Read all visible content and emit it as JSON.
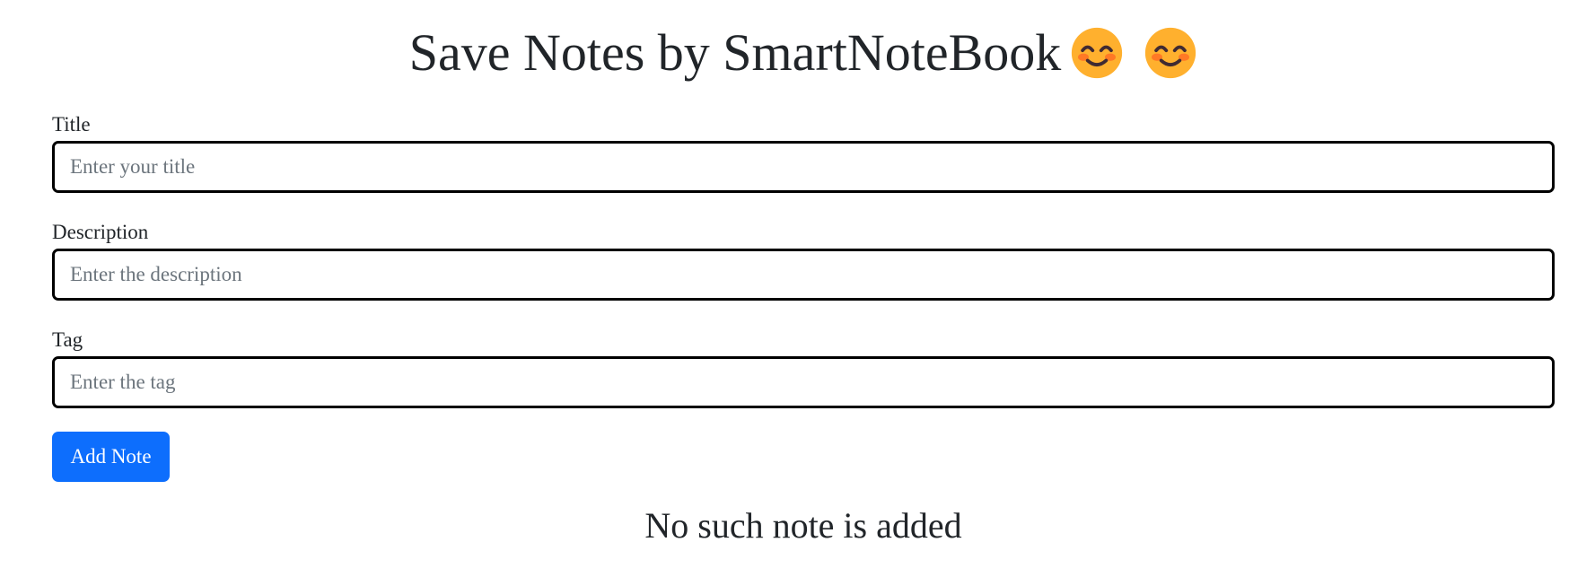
{
  "header": {
    "title": "Save Notes by SmartNoteBook",
    "emojis": [
      "smiling-face-with-smiling-eyes-icon",
      "smiling-face-with-smiling-eyes-icon"
    ]
  },
  "form": {
    "title": {
      "label": "Title",
      "placeholder": "Enter your title",
      "value": ""
    },
    "description": {
      "label": "Description",
      "placeholder": "Enter the description",
      "value": ""
    },
    "tag": {
      "label": "Tag",
      "placeholder": "Enter the tag",
      "value": ""
    },
    "submit_label": "Add Note"
  },
  "notes": {
    "empty_message": "No such note is added",
    "items": []
  },
  "colors": {
    "primary": "#0d6efd",
    "text": "#212529",
    "placeholder": "#6c757d",
    "input_border": "#000000",
    "emoji_face": "#ffb02e",
    "emoji_features": "#402a32",
    "emoji_blush": "#ff6723"
  }
}
